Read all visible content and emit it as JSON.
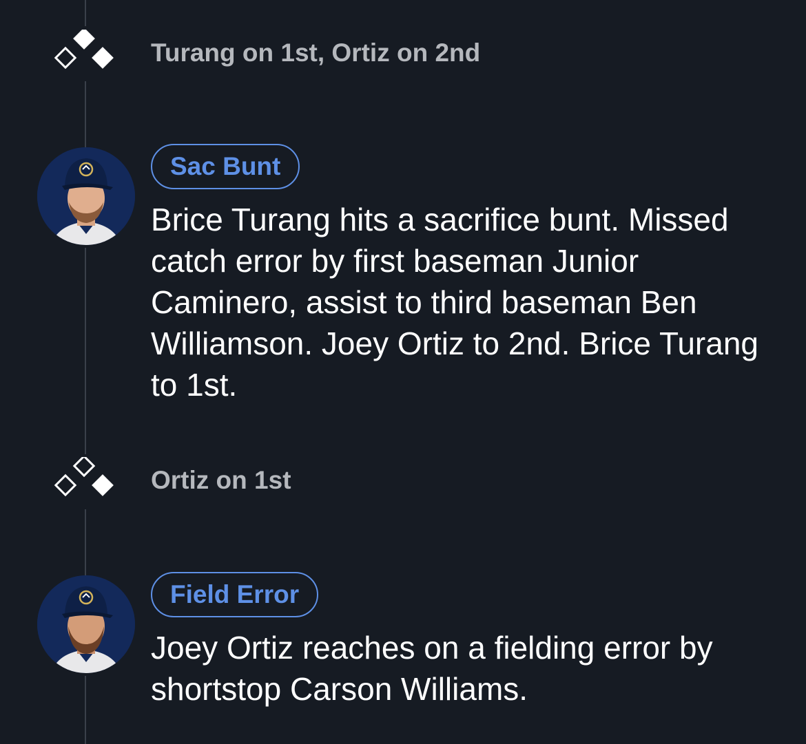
{
  "timeline": [
    {
      "kind": "base_state",
      "text": "Turang on 1st, Ortiz on 2nd",
      "bases_icon": "bases-diamond-icon",
      "occupied": {
        "first": true,
        "second": true,
        "third": false
      }
    },
    {
      "kind": "play",
      "badge": "Sac Bunt",
      "description": "Brice Turang hits a sacrifice bunt. Missed catch error by first baseman Junior Caminero, assist to third baseman Ben Williamson. Joey Ortiz to 2nd. Brice Turang to 1st.",
      "avatar": "player-headshot-icon"
    },
    {
      "kind": "base_state",
      "text": "Ortiz on 1st",
      "bases_icon": "bases-diamond-icon",
      "occupied": {
        "first": true,
        "second": false,
        "third": false
      }
    },
    {
      "kind": "play",
      "badge": "Field Error",
      "description": "Joey Ortiz reaches on a fielding error by shortstop Carson Williams.",
      "avatar": "player-headshot-icon"
    }
  ],
  "colors": {
    "background": "#161b23",
    "accent": "#5e90e6",
    "muted_text": "#b5b8bd",
    "timeline": "#3a404a"
  }
}
